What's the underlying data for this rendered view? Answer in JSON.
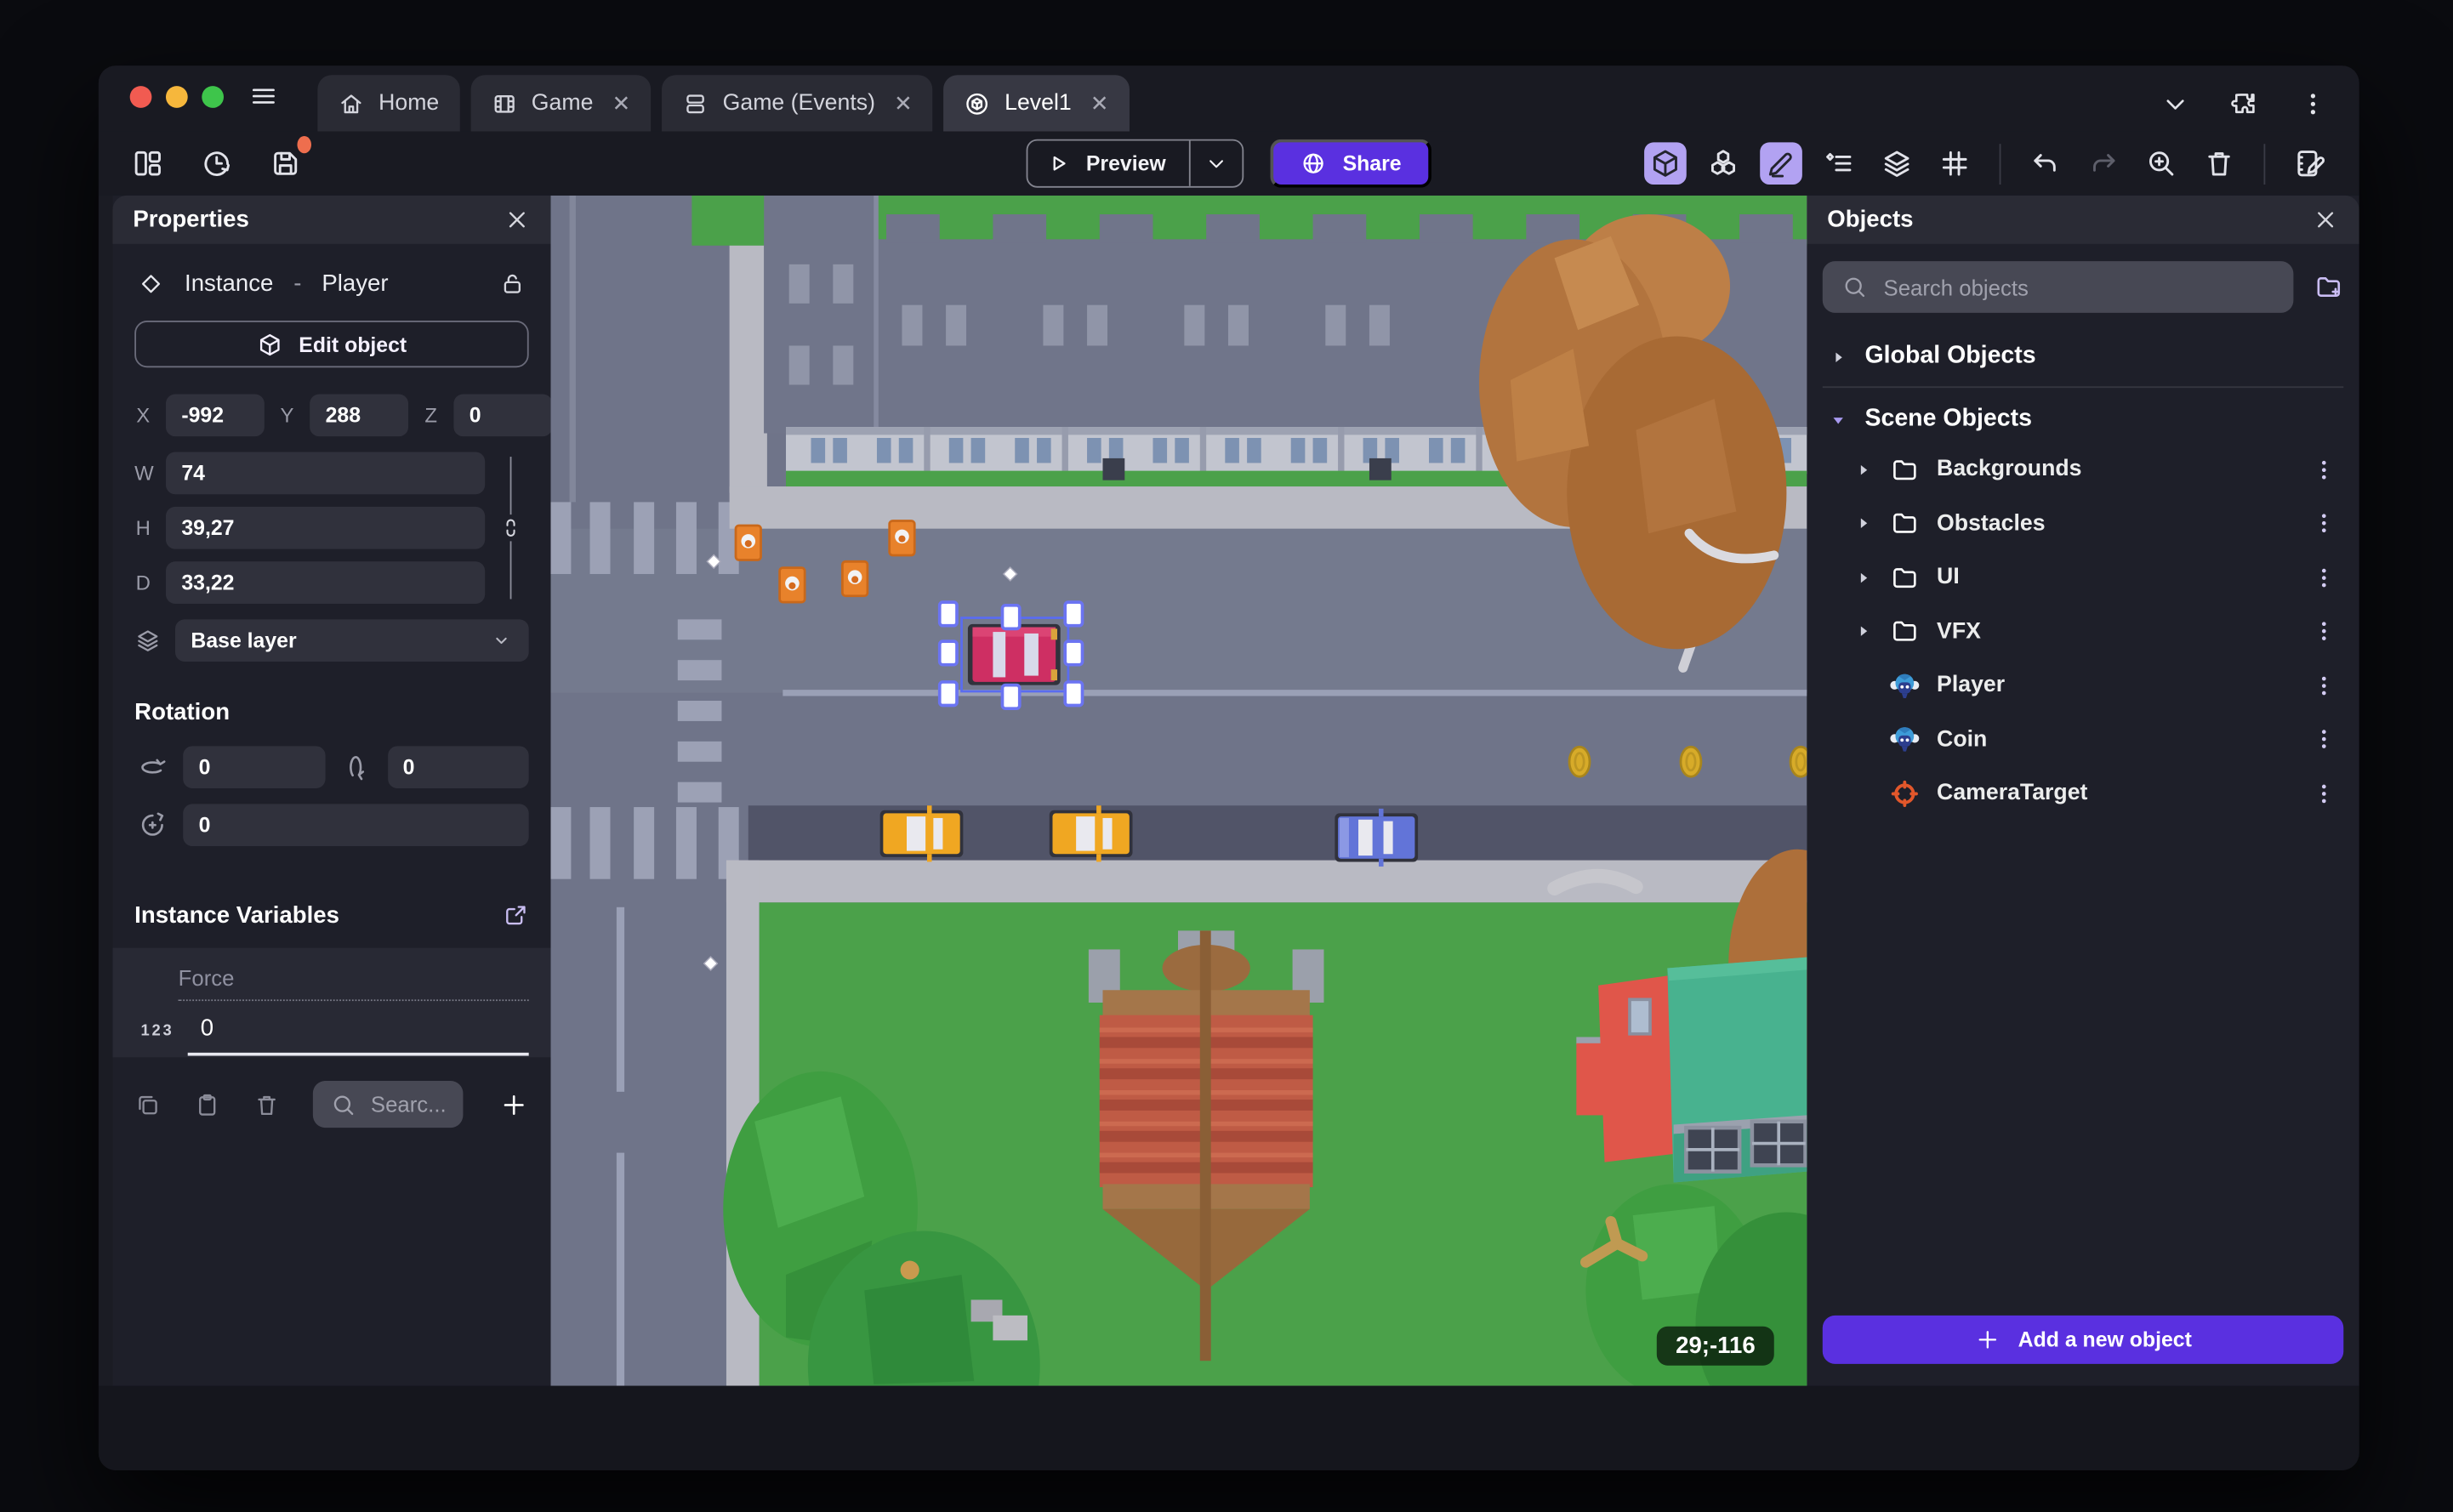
{
  "window": {
    "tabs": [
      {
        "label": "Home",
        "closable": false,
        "active": false
      },
      {
        "label": "Game",
        "closable": true,
        "active": false
      },
      {
        "label": "Game (Events)",
        "closable": true,
        "active": false
      },
      {
        "label": "Level1",
        "closable": true,
        "active": true
      }
    ]
  },
  "toolbar": {
    "preview": "Preview",
    "share": "Share"
  },
  "properties": {
    "title": "Properties",
    "instance_label": "Instance",
    "separator": "-",
    "object_name": "Player",
    "edit_object": "Edit object",
    "position": {
      "x_label": "X",
      "x": "-992",
      "y_label": "Y",
      "y": "288",
      "z_label": "Z",
      "z": "0"
    },
    "size": {
      "w_label": "W",
      "w": "74",
      "h_label": "H",
      "h": "39,27",
      "d_label": "D",
      "d": "33,22"
    },
    "layer": "Base layer",
    "rotation": {
      "title": "Rotation",
      "x": "0",
      "y": "0",
      "z": "0"
    },
    "variables": {
      "title": "Instance Variables",
      "rows": [
        {
          "name": "Force",
          "type": "123",
          "value": "0"
        }
      ],
      "search_placeholder": "Searc..."
    }
  },
  "objects": {
    "title": "Objects",
    "search_placeholder": "Search objects",
    "global_group": "Global Objects",
    "scene_group": "Scene Objects",
    "folders": [
      "Backgrounds",
      "Obstacles",
      "UI",
      "VFX"
    ],
    "items": [
      {
        "name": "Player",
        "icon": "monkey"
      },
      {
        "name": "Coin",
        "icon": "monkey"
      },
      {
        "name": "CameraTarget",
        "icon": "target"
      }
    ],
    "add_button": "Add a new object"
  },
  "canvas": {
    "coords_badge": "29;-116"
  },
  "colors": {
    "accent": "#5a30e0",
    "accent_light": "#b2a2f2",
    "grass_green": "#4ba14a",
    "road": "#6f7489",
    "road_dark": "#515468",
    "sidewalk": "#b9bac3",
    "unsaved_badge": "#ee6e4e",
    "selection_blue": "#5a6cf0",
    "target_orange": "#e2572b"
  }
}
